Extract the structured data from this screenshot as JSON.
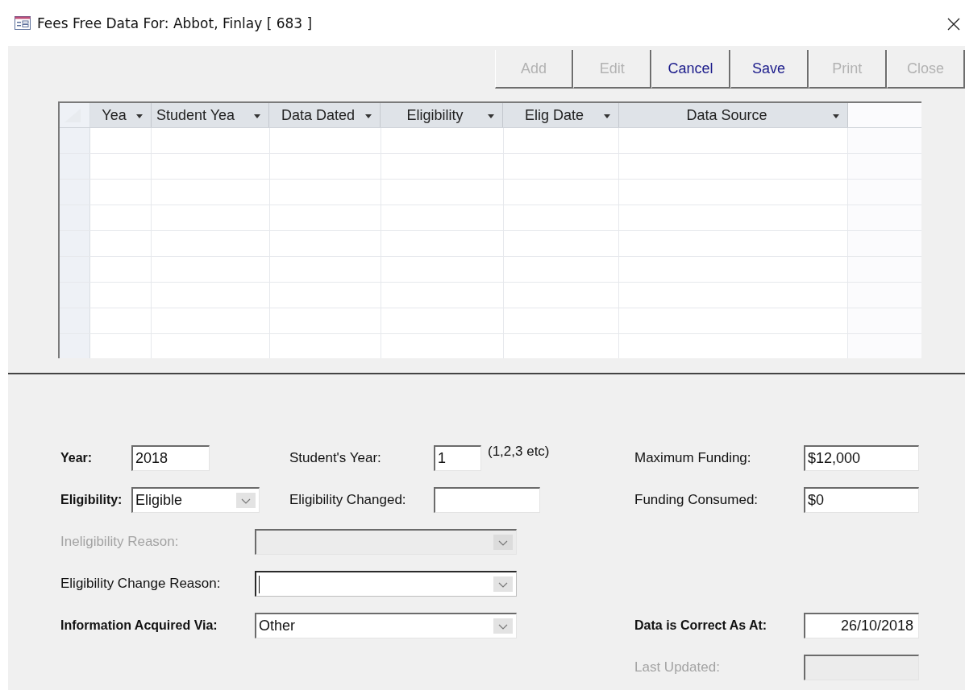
{
  "window": {
    "title": "Fees Free Data For: Abbot, Finlay [ 683 ]"
  },
  "toolbar": [
    {
      "label": "Add",
      "disabled": true
    },
    {
      "label": "Edit",
      "disabled": true
    },
    {
      "label": "Cancel",
      "disabled": false
    },
    {
      "label": "Save",
      "disabled": false
    },
    {
      "label": "Print",
      "disabled": true
    },
    {
      "label": "Close",
      "disabled": true
    }
  ],
  "table": {
    "columns": [
      {
        "label": "Yea"
      },
      {
        "label": "Student Yea"
      },
      {
        "label": "Data Dated"
      },
      {
        "label": "Eligibility"
      },
      {
        "label": "Elig Date"
      },
      {
        "label": "Data Source"
      }
    ]
  },
  "form": {
    "fields": [
      {
        "label": "Year:",
        "kind": "text",
        "value": "2018",
        "emphasis": true,
        "disabled": false,
        "focused": false
      },
      {
        "label": "Student's Year:",
        "kind": "text",
        "value": "1",
        "hint": "(1,2,3 etc)",
        "emphasis": false,
        "disabled": false,
        "focused": false
      },
      {
        "label": "Maximum Funding:",
        "kind": "text",
        "value": "$12,000",
        "emphasis": false,
        "disabled": false,
        "focused": false
      },
      {
        "label": "Eligibility:",
        "kind": "combo",
        "value": "Eligible",
        "emphasis": true,
        "disabled": false,
        "focused": false
      },
      {
        "label": "Eligibility Changed:",
        "kind": "text",
        "emphasis": false,
        "disabled": false,
        "focused": false
      },
      {
        "label": "Funding Consumed:",
        "kind": "text",
        "value": "$0",
        "emphasis": false,
        "disabled": false,
        "focused": false
      },
      {
        "label": "Ineligibility Reason:",
        "kind": "combo",
        "emphasis": false,
        "disabled": true,
        "focused": false
      },
      {
        "label": "Eligibility Change Reason:",
        "kind": "combo",
        "emphasis": false,
        "disabled": false,
        "focused": true
      },
      {
        "label": "Information Acquired Via:",
        "kind": "combo",
        "value": "Other",
        "emphasis": true,
        "disabled": false,
        "focused": false
      },
      {
        "label": "Data is Correct As At:",
        "kind": "text",
        "value": "26/10/2018",
        "emphasis": true,
        "disabled": false,
        "focused": false
      },
      {
        "label": "Last Updated:",
        "kind": "text",
        "emphasis": false,
        "disabled": true,
        "focused": false
      }
    ]
  }
}
